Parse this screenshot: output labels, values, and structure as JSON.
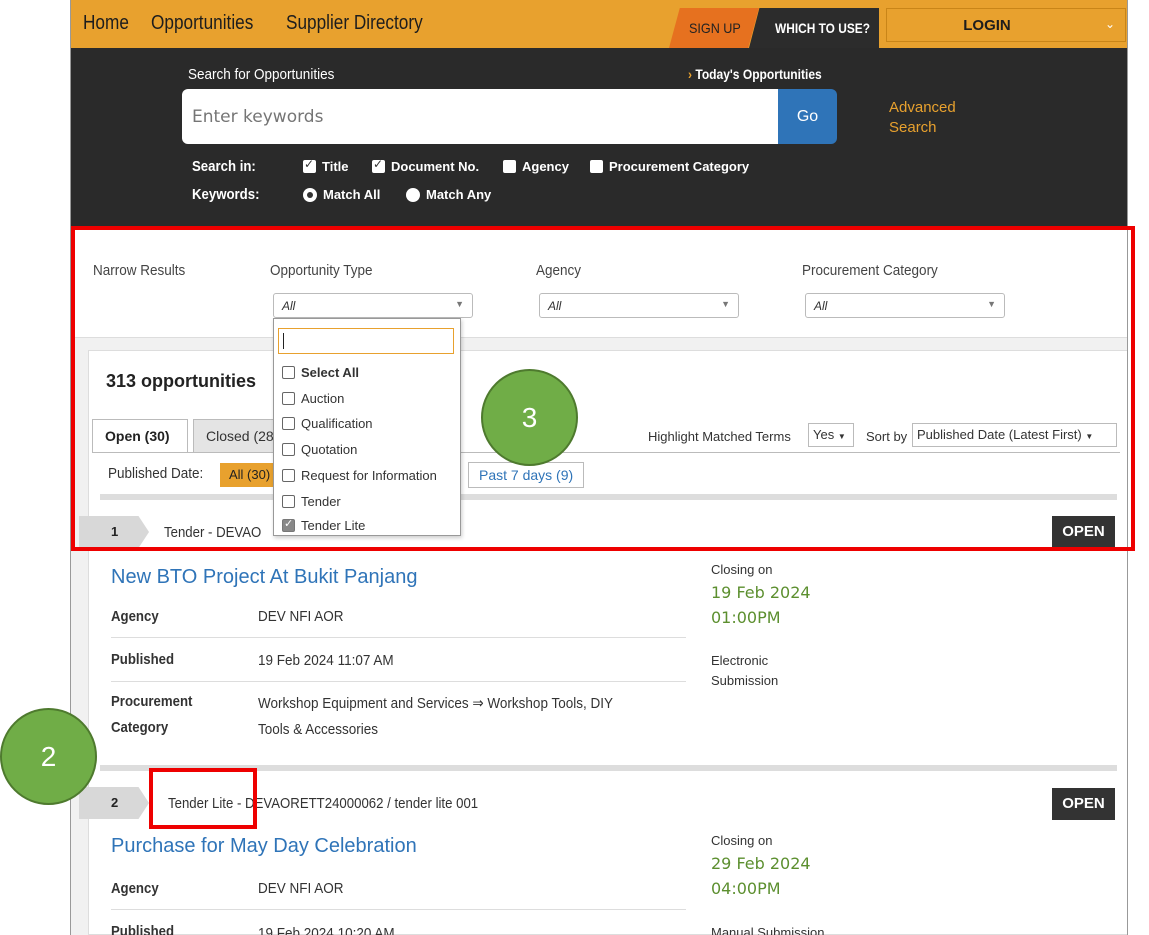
{
  "nav": {
    "home": "Home",
    "opportunities": "Opportunities",
    "supplier_directory": "Supplier Directory",
    "sign_up": "SIGN UP",
    "which_to_use": "WHICH TO USE?",
    "login": "LOGIN"
  },
  "search": {
    "title": "Search for Opportunities",
    "todays": "Today's Opportunities",
    "placeholder": "Enter keywords",
    "go": "Go",
    "advanced_line1": "Advanced",
    "advanced_line2": "Search",
    "search_in_label": "Search in:",
    "search_in": [
      {
        "label": "Title",
        "checked": true
      },
      {
        "label": "Document No.",
        "checked": true
      },
      {
        "label": "Agency",
        "checked": false
      },
      {
        "label": "Procurement Category",
        "checked": false
      }
    ],
    "keywords_label": "Keywords:",
    "match_all": "Match All",
    "match_any": "Match Any"
  },
  "narrow": {
    "label": "Narrow Results",
    "opportunity_type": "Opportunity Type",
    "agency": "Agency",
    "procurement_category": "Procurement Category",
    "all": "All"
  },
  "dropdown": {
    "options": [
      {
        "label": "Select All",
        "checked": false
      },
      {
        "label": "Auction",
        "checked": false
      },
      {
        "label": "Qualification",
        "checked": false
      },
      {
        "label": "Quotation",
        "checked": false
      },
      {
        "label": "Request for Information",
        "checked": false
      },
      {
        "label": "Tender",
        "checked": false
      },
      {
        "label": "Tender Lite",
        "checked": true
      }
    ]
  },
  "results": {
    "count": "313 opportunities",
    "tab_open": "Open (30)",
    "tab_closed": "Closed (28",
    "highlight_label": "Highlight Matched Terms",
    "highlight_value": "Yes",
    "sort_label": "Sort by",
    "sort_value": "Published Date (Latest First)",
    "published_label": "Published Date:",
    "published_all": "All (30)",
    "past7": "Past 7 days (9)"
  },
  "items": [
    {
      "num": "1",
      "ref": "Tender - DEVAO",
      "badge": "OPEN",
      "title": "New BTO Project At Bukit Panjang",
      "agency_label": "Agency",
      "agency": "DEV NFI AOR",
      "published_label": "Published",
      "published": "19 Feb 2024 11:07 AM",
      "category_label_1": "Procurement",
      "category_label_2": "Category",
      "category_1": "Workshop Equipment and Services ⇒ Workshop Tools, DIY",
      "category_2": "Tools & Accessories",
      "closing_label": "Closing on",
      "closing_date": "19 Feb 2024",
      "closing_time": "01:00PM",
      "submission_1": "Electronic",
      "submission_2": "Submission"
    },
    {
      "num": "2",
      "type": "Tender Lite",
      "ref": "- DEVAORETT24000062 / tender lite 001",
      "badge": "OPEN",
      "title": "Purchase for May Day Celebration",
      "agency_label": "Agency",
      "agency": "DEV NFI AOR",
      "published_label": "Published",
      "published": "19 Feb 2024 10:20 AM",
      "closing_label": "Closing on",
      "closing_date": "29 Feb 2024",
      "closing_time": "04:00PM",
      "submission_1": "Manual Submission"
    }
  ],
  "annotations": {
    "callout_2": "2",
    "callout_3": "3"
  },
  "colors": {
    "accent": "#e8a12e",
    "link": "#2f74b8",
    "date_green": "#5c8f2f",
    "annotation_red": "#ee0000",
    "callout_green": "#70ad47"
  }
}
